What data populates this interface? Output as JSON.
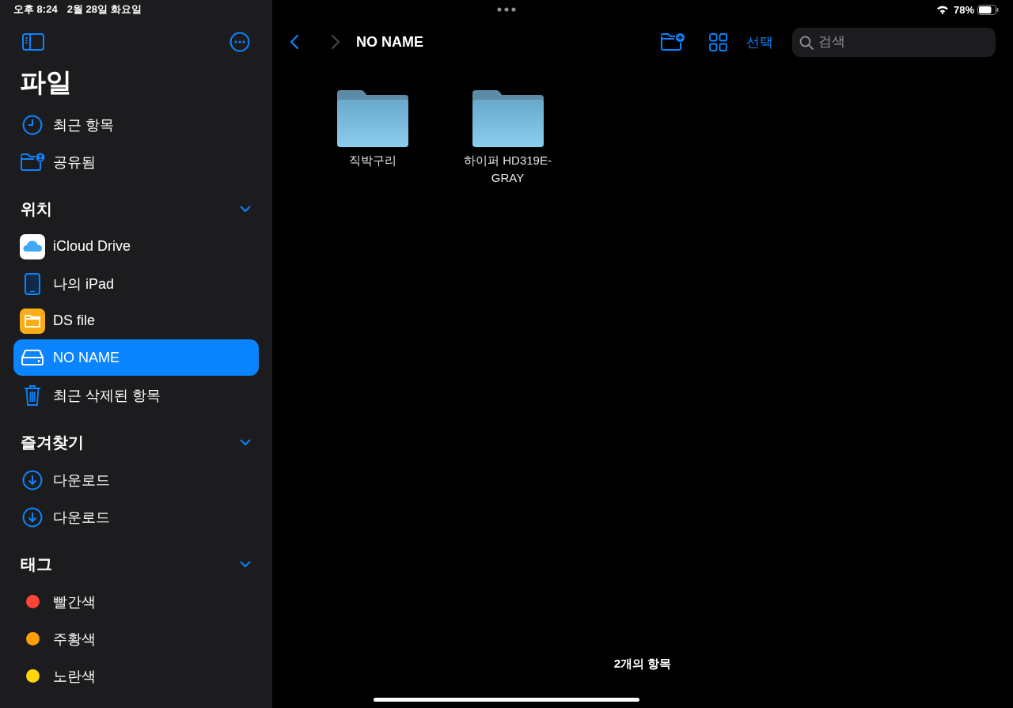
{
  "status_bar": {
    "time": "오후 8:24",
    "date": "2월 28일 화요일",
    "battery": "78%"
  },
  "sidebar": {
    "title": "파일",
    "top_items": [
      {
        "kind": "clock",
        "label": "최근 항목",
        "selected": false
      },
      {
        "kind": "shared",
        "label": "공유됨",
        "selected": false
      }
    ],
    "sections": [
      {
        "title": "위치",
        "expanded": true,
        "items": [
          {
            "kind": "icloud",
            "label": "iCloud Drive",
            "selected": false
          },
          {
            "kind": "ipad",
            "label": "나의 iPad",
            "selected": false
          },
          {
            "kind": "app-folder",
            "label": "DS file",
            "selected": false
          },
          {
            "kind": "drive",
            "label": "NO NAME",
            "selected": true
          },
          {
            "kind": "trash",
            "label": "최근 삭제된 항목",
            "selected": false
          }
        ]
      },
      {
        "title": "즐겨찾기",
        "expanded": true,
        "items": [
          {
            "kind": "download",
            "label": "다운로드",
            "selected": false
          },
          {
            "kind": "download",
            "label": "다운로드",
            "selected": false
          }
        ]
      },
      {
        "title": "태그",
        "expanded": true,
        "items": [
          {
            "kind": "tag",
            "label": "빨간색",
            "color": "#ff453a",
            "selected": false
          },
          {
            "kind": "tag",
            "label": "주황색",
            "color": "#ff9f0a",
            "selected": false
          },
          {
            "kind": "tag",
            "label": "노란색",
            "color": "#ffd60a",
            "selected": false
          }
        ]
      }
    ]
  },
  "toolbar": {
    "back_disabled": false,
    "forward_disabled": true,
    "title": "NO NAME",
    "select": "선택",
    "search": {
      "placeholder": "검색"
    }
  },
  "folders": [
    {
      "name": "직박구리"
    },
    {
      "name": "하이퍼 HD319E-GRAY"
    }
  ],
  "footer": "2개의 항목"
}
